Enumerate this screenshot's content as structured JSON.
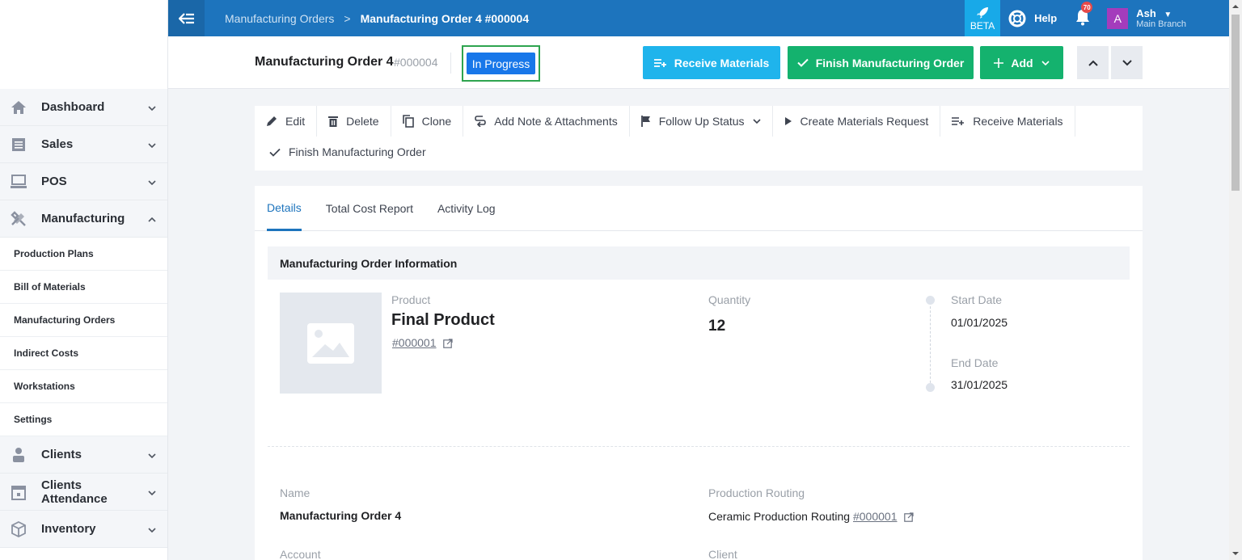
{
  "sidebar": {
    "items": [
      {
        "label": "Dashboard",
        "icon": "home-icon"
      },
      {
        "label": "Sales",
        "icon": "sales-icon"
      },
      {
        "label": "POS",
        "icon": "pos-icon"
      },
      {
        "label": "Manufacturing",
        "icon": "tools-icon"
      }
    ],
    "sub_items": [
      "Production Plans",
      "Bill of Materials",
      "Manufacturing Orders",
      "Indirect Costs",
      "Workstations",
      "Settings"
    ],
    "items_after": [
      {
        "label": "Clients",
        "icon": "clients-icon"
      },
      {
        "label": "Clients Attendance",
        "icon": "calendar-icon"
      },
      {
        "label": "Inventory",
        "icon": "box-icon"
      }
    ]
  },
  "topbar": {
    "breadcrumb_parent": "Manufacturing Orders",
    "breadcrumb_sep": ">",
    "breadcrumb_current": "Manufacturing Order 4 #000004",
    "beta_label": "BETA",
    "help_label": "Help",
    "notification_count": "70",
    "avatar_letter": "A",
    "user_name": "Ash",
    "user_branch": "Main Branch"
  },
  "header": {
    "title": "Manufacturing Order 4",
    "number": "#000004",
    "status": "In Progress",
    "receive_label": "Receive Materials",
    "finish_label": "Finish Manufacturing Order",
    "add_label": "Add"
  },
  "actions": {
    "edit": "Edit",
    "delete": "Delete",
    "clone": "Clone",
    "note": "Add Note & Attachments",
    "follow_up": "Follow Up Status",
    "create_request": "Create Materials Request",
    "receive": "Receive Materials",
    "finish": "Finish Manufacturing Order"
  },
  "tabs": [
    "Details",
    "Total Cost Report",
    "Activity Log"
  ],
  "details": {
    "section_title": "Manufacturing Order Information",
    "product_label": "Product",
    "product_name": "Final Product",
    "product_link": "#000001",
    "quantity_label": "Quantity",
    "quantity": "12",
    "start_label": "Start Date",
    "start_date": "01/01/2025",
    "end_label": "End Date",
    "end_date": "31/01/2025",
    "name_label": "Name",
    "name_value": "Manufacturing Order 4",
    "routing_label": "Production Routing",
    "routing_value": "Ceramic Production Routing",
    "routing_link": "#000001",
    "account_label": "Account",
    "client_label": "Client"
  },
  "colors": {
    "topbar": "#1d74bd",
    "status": "#1877e9",
    "receive": "#1fb4ec",
    "finish": "#14b26e"
  }
}
